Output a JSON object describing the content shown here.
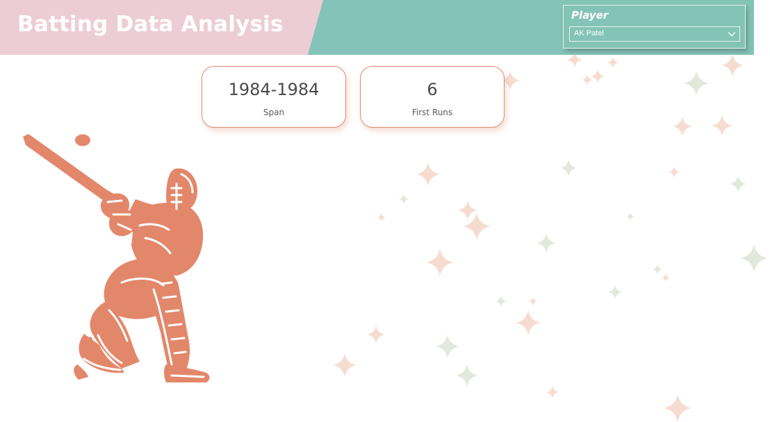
{
  "header": {
    "title": "Batting Data Analysis"
  },
  "slicer": {
    "title": "Player",
    "selected_value": "AK Patel"
  },
  "kpis": [
    {
      "value": "1984-1984",
      "label": "Span"
    },
    {
      "value": "6",
      "label": "First Runs"
    }
  ],
  "icons": {
    "dropdown": "chevron-down-icon",
    "illustration": "cricket-batsman-icon",
    "decoration": "sparkle-icon"
  },
  "colors": {
    "header_pink": "#eccdd6",
    "header_teal": "#84c3b8",
    "accent_salmon": "#e3876b",
    "kpi_text": "#4a4a4a",
    "sparkle_peach": "#f6dcd0",
    "sparkle_sage": "#e2e8dc",
    "background": "#ffffff"
  }
}
